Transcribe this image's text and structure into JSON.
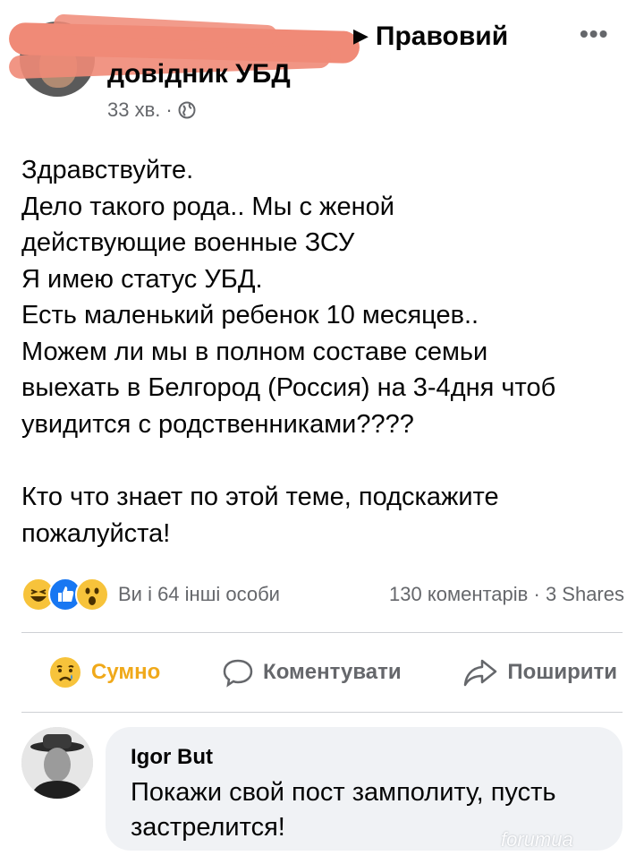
{
  "post": {
    "title_line1": "Правовий",
    "title_line2": "довідник УБД",
    "time": "33 хв.",
    "dot": "·",
    "more": "•••",
    "text_lines": [
      "Здравствуйте.",
      "Дело такого рода.. Мы с женой",
      "действующие военные ЗСУ",
      "Я имею статус УБД.",
      "Есть маленький ребенок 10 месяцев..",
      "Можем ли мы в полном составе семьи",
      "выехать в Белгород (Россия) на 3-4дня чтоб",
      "увидится с родственниками????"
    ],
    "text_lines_2": [
      "Кто что знает по этой теме, подскажите",
      "пожалуйста!"
    ]
  },
  "reactions": {
    "label": "Ви і 64 інші особи",
    "comments": "130 коментарів",
    "separator": "·",
    "shares": "3 Shares"
  },
  "actions": {
    "react_label": "Сумно",
    "comment_label": "Коментувати",
    "share_label": "Поширити"
  },
  "comment": {
    "author": "Igor But",
    "text": "Покажи свой пост замполиту, пусть застрелится!"
  },
  "watermark": "forumua",
  "colors": {
    "secondary_text": "#65676b",
    "sad_reaction": "#f0a91a",
    "like_blue": "#1877f2",
    "comment_bg": "#f0f2f5",
    "redaction": "#f08a77"
  },
  "icons": [
    "globe-icon",
    "haha-icon",
    "like-icon",
    "wow-icon",
    "sad-icon",
    "comment-icon",
    "share-icon",
    "more-icon"
  ]
}
